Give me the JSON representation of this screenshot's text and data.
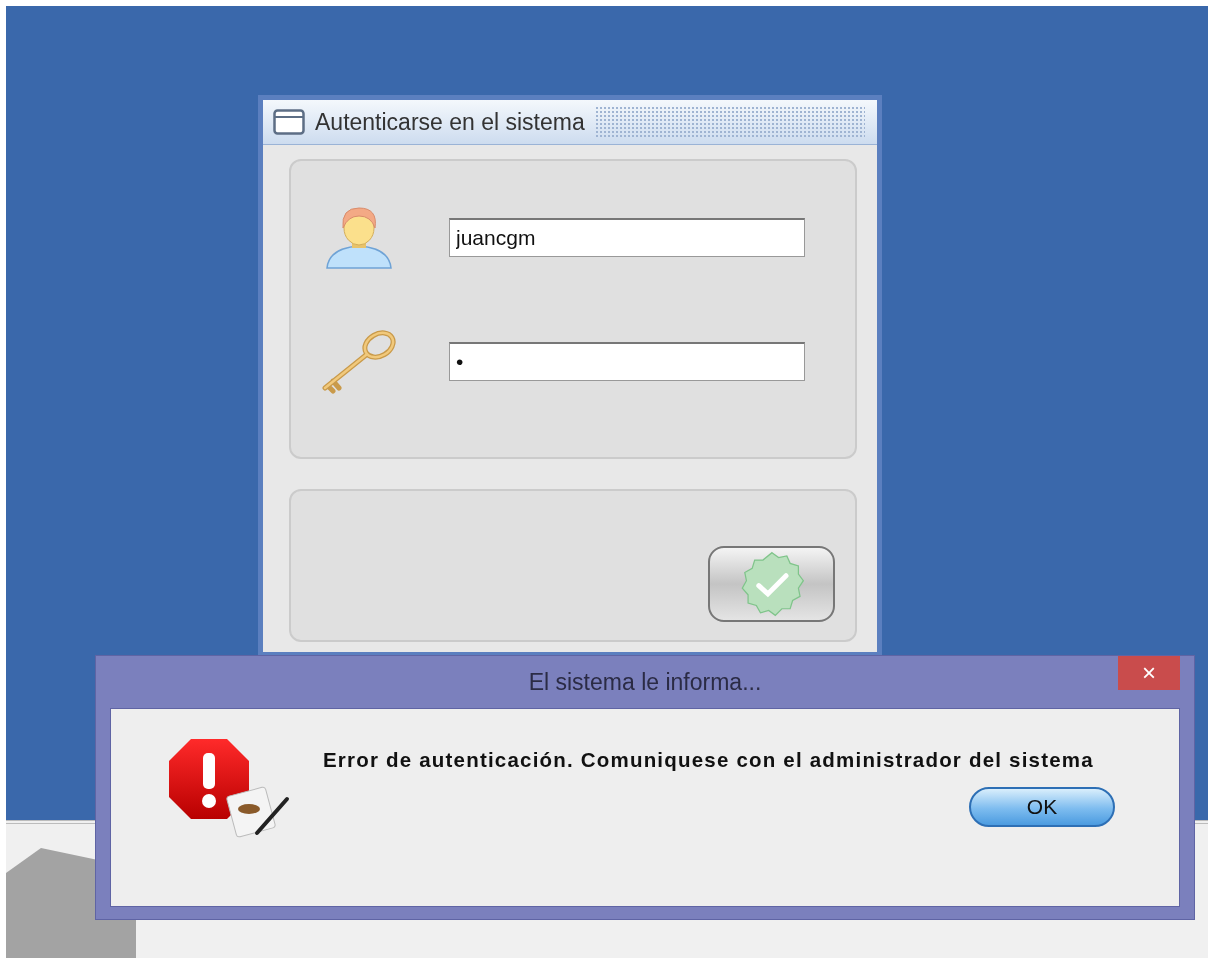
{
  "login_window": {
    "title": "Autenticarse en el sistema",
    "username": {
      "value": "juancgm"
    },
    "password": {
      "value": "•"
    }
  },
  "message_dialog": {
    "title": "El sistema le informa...",
    "close_label": "×",
    "message": "Error de autenticación. Comuniquese con el administrador del sistema",
    "button": "OK"
  }
}
